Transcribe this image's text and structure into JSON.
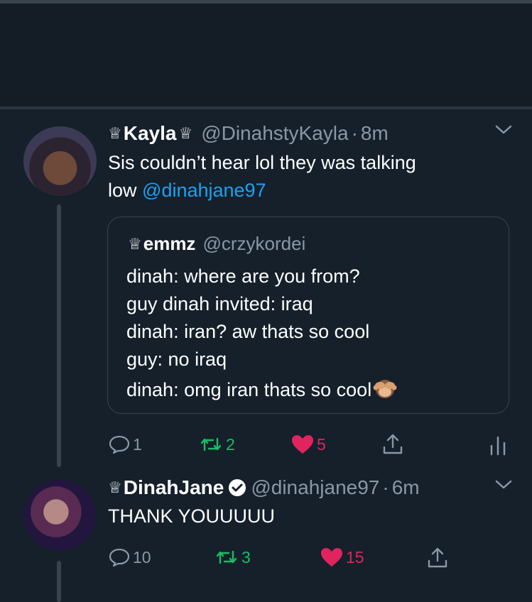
{
  "tweet1": {
    "crown": "♕",
    "name": "Kayla",
    "handle": "@DinahstyKayla",
    "separator": "·",
    "time": "8m",
    "text_line1": "Sis couldn’t hear lol they was talking",
    "text_line2_prefix": "low",
    "mention": "@dinahjane97",
    "quote": {
      "crown": "♕",
      "name": "emmz",
      "handle": "@crzykordei",
      "lines": [
        "dinah: where are you from?",
        "guy dinah invited: iraq",
        "dinah: iran? aw thats so cool",
        "guy: no iraq",
        "dinah: omg iran thats so cool"
      ],
      "emoji_icon": "see-no-evil-monkey-icon"
    },
    "actions": {
      "replies": "1",
      "retweets": "2",
      "likes": "5"
    }
  },
  "tweet2": {
    "crown": "♕",
    "name": "DinahJane",
    "handle": "@dinahjane97",
    "separator": "·",
    "time": "6m",
    "text": "THANK YOUUUUU",
    "actions": {
      "replies": "10",
      "retweets": "3",
      "likes": "15"
    }
  },
  "colors": {
    "background": "#15202b",
    "link": "#1da1f2",
    "retweet": "#17bf63",
    "like": "#e0245e",
    "muted": "#8899a6"
  },
  "icons": [
    "reply-icon",
    "retweet-icon",
    "heart-icon",
    "share-icon",
    "analytics-icon",
    "chevron-down-icon",
    "verified-badge-icon"
  ]
}
